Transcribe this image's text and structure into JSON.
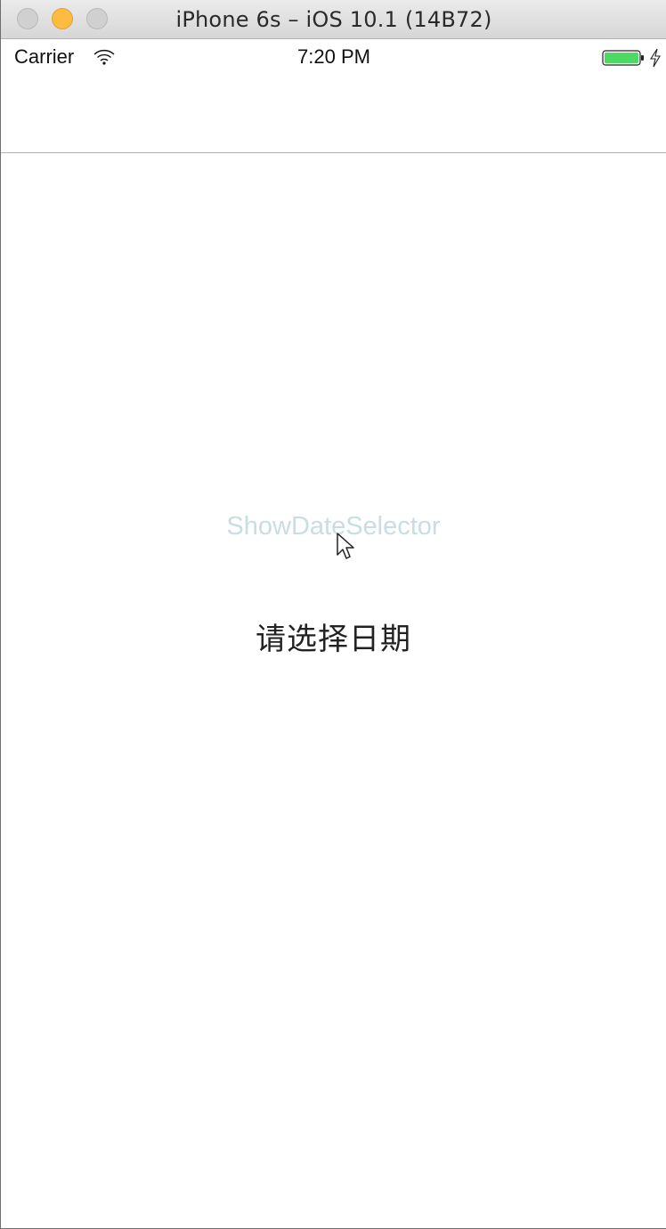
{
  "window": {
    "title": "iPhone 6s – iOS 10.1 (14B72)"
  },
  "status_bar": {
    "carrier": "Carrier",
    "time": "7:20 PM",
    "battery_color": "#4cd964"
  },
  "icons": {
    "wifi": "wifi-icon",
    "battery": "battery-icon",
    "charging": "charging-bolt-icon",
    "cursor": "mouse-cursor-icon"
  },
  "content": {
    "button_label": "ShowDateSelector",
    "button_color": "#c9dde4",
    "date_label": "请选择日期"
  }
}
